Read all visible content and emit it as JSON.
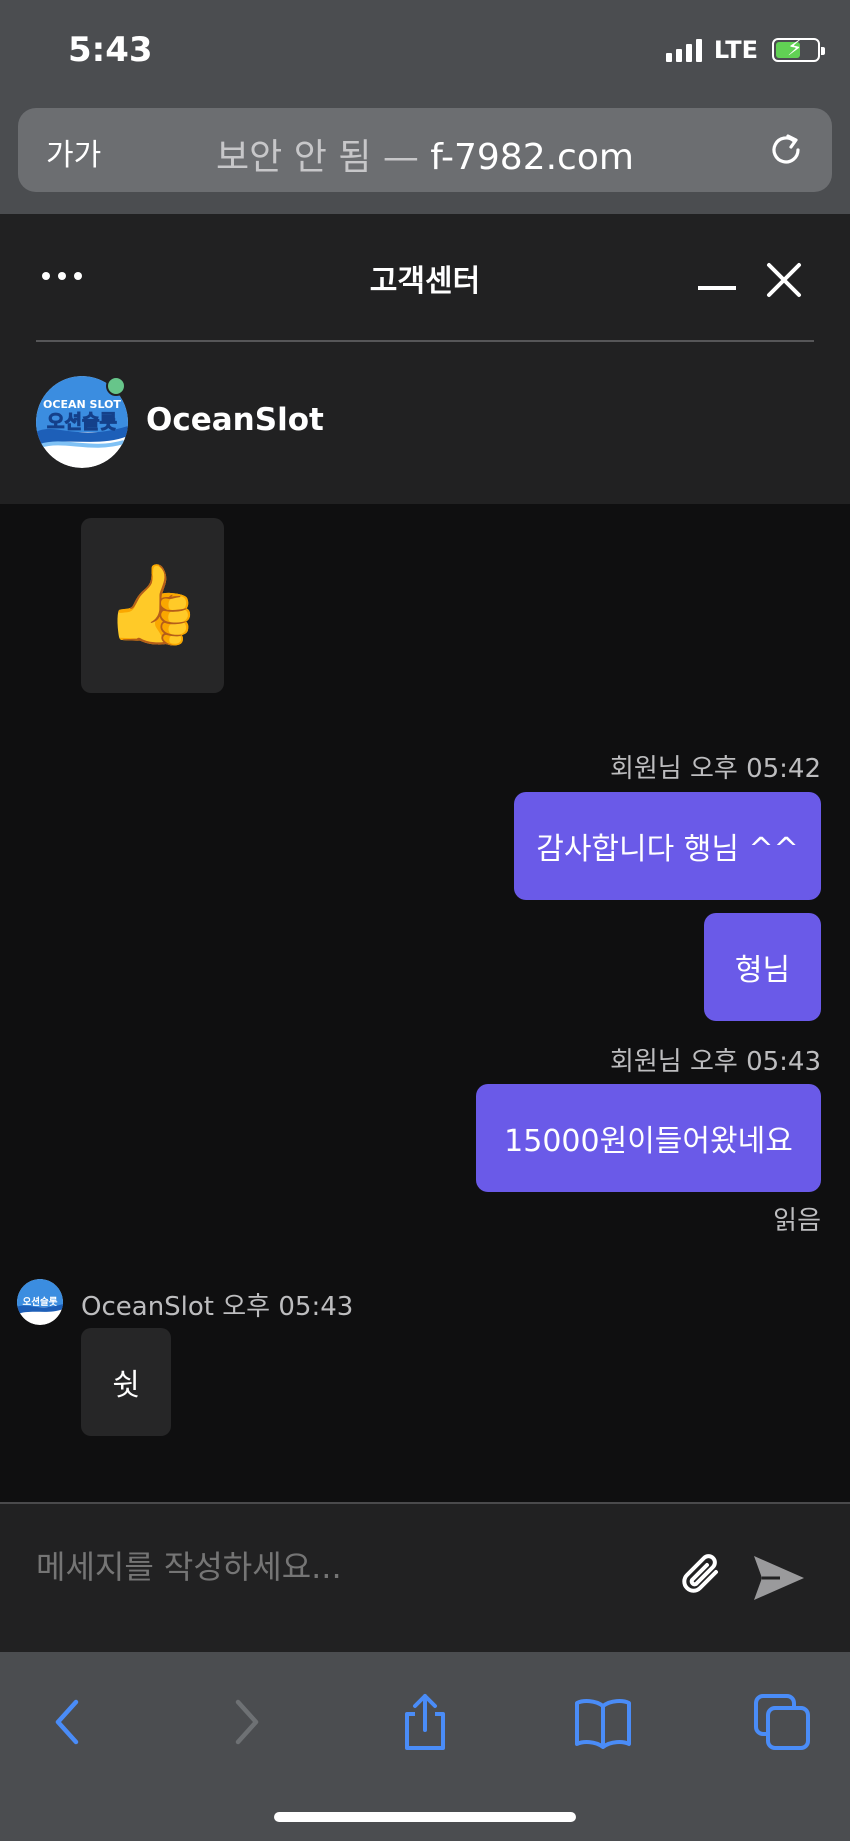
{
  "status_bar": {
    "time": "5:43",
    "network": "LTE"
  },
  "browser": {
    "text_size_label": "가가",
    "security_label": "보안 안 됨 — ",
    "domain": "f-7982.com"
  },
  "chat": {
    "title": "고객센터",
    "agent_name": "OceanSlot",
    "logo_text_top": "OCEAN SLOT",
    "logo_text_main": "오션슬롯"
  },
  "messages": {
    "emoji": "👍",
    "out_group_1": {
      "meta": "회원님 오후 05:42",
      "bubbles": [
        "감사합니다 행님 ^^",
        "형님"
      ]
    },
    "out_group_2": {
      "meta": "회원님 오후 05:43",
      "bubbles": [
        "15000원이들어왔네요"
      ],
      "read_label": "읽음"
    },
    "in_group": {
      "meta": "OceanSlot 오후 05:43",
      "bubbles": [
        "쉿"
      ]
    }
  },
  "composer": {
    "placeholder": "메세지를 작성하세요..."
  },
  "colors": {
    "accent": "#6a5ae8",
    "online": "#67c58a",
    "ios_blue": "#4a8cf7"
  },
  "icons": [
    "more-icon",
    "minimize-icon",
    "close-icon",
    "reload-icon",
    "attach-icon",
    "send-icon",
    "back-icon",
    "forward-icon",
    "share-icon",
    "bookmarks-icon",
    "tabs-icon"
  ]
}
